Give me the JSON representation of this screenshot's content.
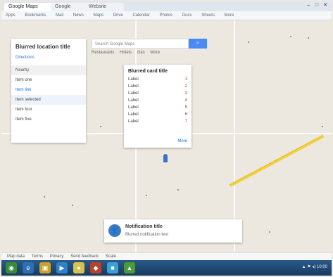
{
  "browser": {
    "tabs": [
      {
        "label": "Google Maps"
      },
      {
        "label": "Google"
      },
      {
        "label": "Website"
      }
    ],
    "window_buttons": [
      "–",
      "□",
      "✕"
    ],
    "bookmarks": [
      "Apps",
      "Bookmarks",
      "Mail",
      "News",
      "Maps",
      "Drive",
      "Calendar",
      "Photos",
      "Docs",
      "Sheets",
      "More"
    ]
  },
  "search": {
    "placeholder": "Search Google Maps",
    "button_icon": "search-icon",
    "chips": [
      "Restaurants",
      "Hotels",
      "Gas",
      "More"
    ]
  },
  "panel": {
    "title": "Blurred location title",
    "subtitle": "Directions",
    "section": "Nearby",
    "items": [
      {
        "label": "Item one"
      },
      {
        "label": "Item link"
      },
      {
        "label": "Item selected"
      },
      {
        "label": "Item four"
      },
      {
        "label": "Item five"
      }
    ]
  },
  "card": {
    "title": "Blurred card title",
    "rows": [
      {
        "k": "Label",
        "v": "1"
      },
      {
        "k": "Label",
        "v": "2"
      },
      {
        "k": "Label",
        "v": "3"
      },
      {
        "k": "Label",
        "v": "4"
      },
      {
        "k": "Label",
        "v": "5"
      },
      {
        "k": "Label",
        "v": "6"
      },
      {
        "k": "Label",
        "v": "7"
      }
    ],
    "footer": "More"
  },
  "notification": {
    "title": "Notification title",
    "text": "Blurred notification text",
    "icon": "user-icon"
  },
  "mapbar": {
    "items": [
      "Map data",
      "Terms",
      "Privacy",
      "Send feedback",
      "Scale"
    ]
  },
  "taskbar": {
    "apps": [
      {
        "icon": "start-icon",
        "glyph": "◉"
      },
      {
        "icon": "ie-icon",
        "glyph": "e"
      },
      {
        "icon": "folder-icon",
        "glyph": "▣"
      },
      {
        "icon": "media-icon",
        "glyph": "▶"
      },
      {
        "icon": "chrome-icon",
        "glyph": "●"
      },
      {
        "icon": "app-icon",
        "glyph": "◆"
      },
      {
        "icon": "app2-icon",
        "glyph": "■"
      },
      {
        "icon": "app3-icon",
        "glyph": "▲"
      }
    ],
    "tray_text": "▲ ⚑ ◂) 10:00"
  },
  "colors": {
    "accent": "#4a8af4",
    "map_bg": "#ece8df",
    "taskbar": "#1f4a78",
    "highway": "#f2cf3d"
  }
}
